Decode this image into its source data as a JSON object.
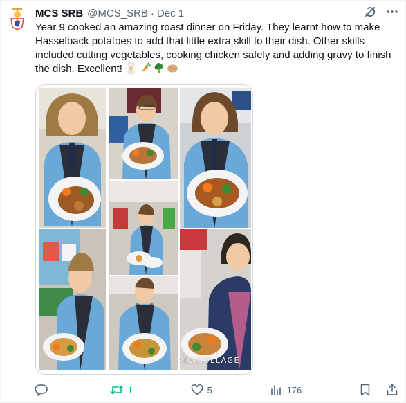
{
  "tweet": {
    "display_name": "MCS SRB",
    "handle": "@MCS_SRB",
    "separator": "·",
    "date": "Dec 1",
    "text": "Year 9 cooked an amazing roast dinner on Friday. They learnt how to make Hasselback potatoes to add that little extra skill to their dish. Other skills included cutting vegetables, cooking chicken safely and adding gravy to finish the dish. Excellent!",
    "emojis": [
      "cook-emoji",
      "carrot-emoji",
      "broccoli-emoji",
      "potato-emoji"
    ]
  },
  "media": {
    "watermark": "PIC·COLLAGE"
  },
  "actions": {
    "replies": "",
    "retweets": "1",
    "likes": "5",
    "views": "176"
  },
  "colors": {
    "retweet_green": "#00ba7c",
    "muted_text": "#536471",
    "border": "#cfd9de"
  },
  "icons": [
    "school-crest-icon",
    "grok-icon",
    "more-icon",
    "reply-icon",
    "retweet-icon",
    "like-icon",
    "views-icon",
    "bookmark-icon",
    "share-icon"
  ]
}
